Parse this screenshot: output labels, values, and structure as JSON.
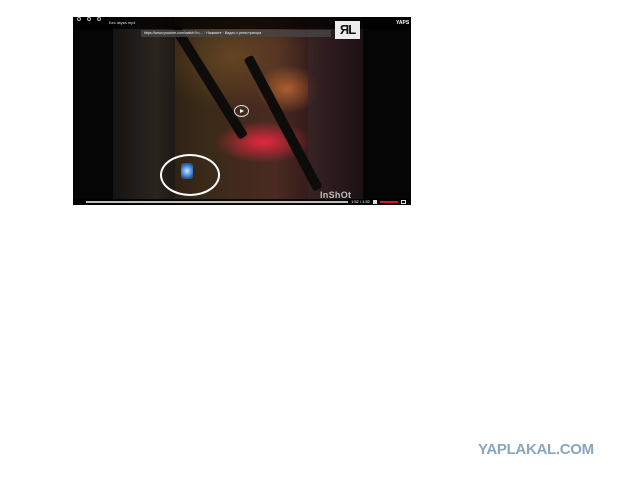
{
  "player": {
    "top_bar": {
      "title": "Без звука.mp4",
      "url_text": "https://www.youtube.com/watch?v=... · Нажмите · Видео с регистратора",
      "corner_mark": "YAPS"
    },
    "channel_logo": "ЯL",
    "video_watermark": "InShOt",
    "controls": {
      "time": "1:52 / 1:52",
      "progress": 1.0
    },
    "annotation": "white-circle-highlight"
  },
  "site_watermark": "YAPLAKAL.COM",
  "colors": {
    "background": "#ffffff",
    "player_bg": "#050505",
    "volume_accent": "#e0102c",
    "site_watermark": "#8aa6be"
  },
  "icons": [
    "refresh-icon",
    "settings-icon",
    "share-icon",
    "play-icon",
    "volume-icon",
    "fullscreen-icon"
  ]
}
